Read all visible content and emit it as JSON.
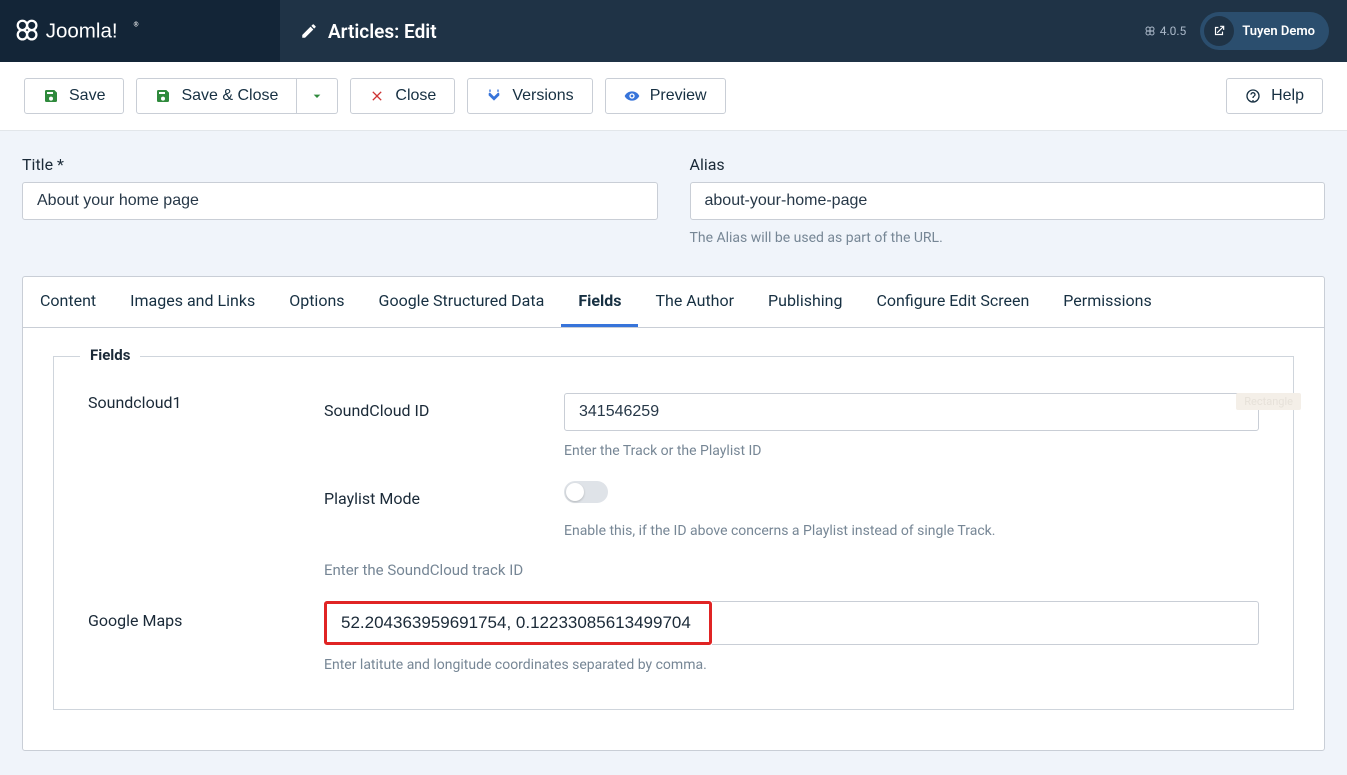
{
  "header": {
    "brand": "Joomla!",
    "page_title": "Articles: Edit",
    "version": "4.0.5",
    "user_name": "Tuyen Demo"
  },
  "toolbar": {
    "save": "Save",
    "save_close": "Save & Close",
    "close": "Close",
    "versions": "Versions",
    "preview": "Preview",
    "help": "Help"
  },
  "form": {
    "title_label": "Title *",
    "title_value": "About your home page",
    "alias_label": "Alias",
    "alias_value": "about-your-home-page",
    "alias_help": "The Alias will be used as part of the URL."
  },
  "tabs": [
    "Content",
    "Images and Links",
    "Options",
    "Google Structured Data",
    "Fields",
    "The Author",
    "Publishing",
    "Configure Edit Screen",
    "Permissions"
  ],
  "fields_panel": {
    "legend": "Fields",
    "group1": "Soundcloud1",
    "sc_label": "SoundCloud ID",
    "sc_value": "341546259",
    "sc_help": "Enter the Track or the Playlist ID",
    "pm_label": "Playlist Mode",
    "pm_help": "Enable this, if the ID above concerns a Playlist instead of single Track.",
    "sc_subhelp": "Enter the SoundCloud track ID",
    "gm_group": "Google Maps",
    "gm_value": "52.204363959691754, 0.12233085613499704",
    "gm_help": "Enter latitute and longitude coordinates separated by comma."
  },
  "misc": {
    "rectangle": "Rectangle"
  }
}
